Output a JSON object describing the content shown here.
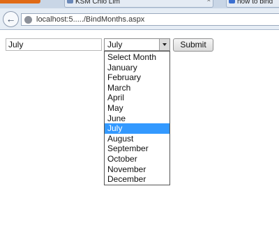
{
  "browser": {
    "tabs": [
      {
        "label": "KSM Chio Lim",
        "active": true
      },
      {
        "label": "how to bind",
        "active": false
      }
    ],
    "back_icon": "back-arrow-icon",
    "address": "localhost:5...../BindMonths.aspx"
  },
  "form": {
    "textbox_value": "July",
    "select_value": "July",
    "submit_label": "Submit",
    "options": [
      {
        "label": "Select Month",
        "selected": false
      },
      {
        "label": "January",
        "selected": false
      },
      {
        "label": "February",
        "selected": false
      },
      {
        "label": "March",
        "selected": false
      },
      {
        "label": "April",
        "selected": false
      },
      {
        "label": "May",
        "selected": false
      },
      {
        "label": "June",
        "selected": false
      },
      {
        "label": "July",
        "selected": true
      },
      {
        "label": "August",
        "selected": false
      },
      {
        "label": "September",
        "selected": false
      },
      {
        "label": "October",
        "selected": false
      },
      {
        "label": "November",
        "selected": false
      },
      {
        "label": "December",
        "selected": false
      }
    ]
  },
  "colors": {
    "selection": "#3399ff",
    "menu_button": "#e06a16"
  }
}
